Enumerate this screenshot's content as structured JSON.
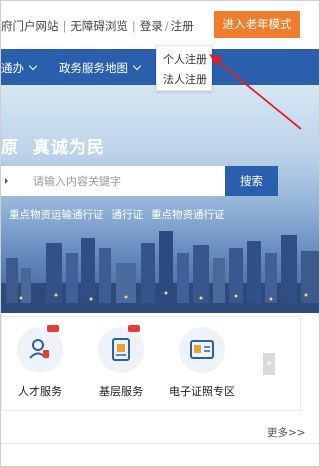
{
  "topbar": {
    "portal_link": "政府门户网站",
    "portal_link_visible": "府门户网站",
    "separator": "|",
    "accessibility_link": "无障碍浏览",
    "login_link": "登录",
    "slash": "/",
    "register_link": "注册",
    "elder_mode_button": "进入老年模式"
  },
  "register_dropdown": {
    "items": [
      "个人注册",
      "法人注册"
    ]
  },
  "nav": {
    "items": [
      "通办",
      "政务服务地图"
    ]
  },
  "hero": {
    "slogan_part1": "原",
    "slogan_part2": "真诚为民",
    "search": {
      "placeholder": "请输入内容关键字",
      "button": "搜索"
    },
    "hotwords": [
      "重点物资运输通行证",
      "通行证",
      "重点物资通行证"
    ]
  },
  "services": {
    "items": [
      {
        "label": "人才服务",
        "icon": "person-icon"
      },
      {
        "label": "基层服务",
        "icon": "document-badge-icon"
      },
      {
        "label": "电子证照专区",
        "icon": "id-card-icon"
      }
    ],
    "next_label": "»"
  },
  "more_link": "更多>>",
  "colors": {
    "primary_blue": "#2a5fae",
    "orange": "#ee7d2d",
    "badge_red": "#e53d30",
    "annotation_red": "#e02020"
  }
}
